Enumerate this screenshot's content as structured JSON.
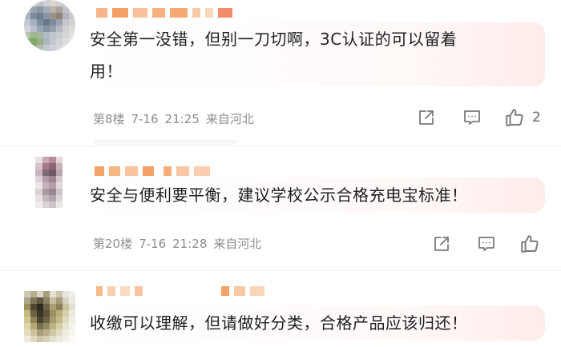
{
  "colors": {
    "text": "#1e1e1e",
    "meta": "#8e8e8e",
    "icon": "#7a7a7a",
    "nickname_mosaic": "#f5a067",
    "bubble_tint": "#fdecea"
  },
  "comments": [
    {
      "text_line1": "安全第一没错，但别一刀切啊，3C认证的可以留着",
      "text_line2": "用！",
      "floor": "第8楼",
      "date": "7-16",
      "time": "21:25",
      "source": "来自河北",
      "like_count": "2",
      "icons": [
        "share-icon",
        "comment-icon",
        "thumbs-up-icon"
      ]
    },
    {
      "text_line1": "安全与便利要平衡，建议学校公示合格充电宝标准！",
      "floor": "第20楼",
      "date": "7-16",
      "time": "21:28",
      "source": "来自河北",
      "icons": [
        "share-icon",
        "comment-icon",
        "thumbs-up-icon"
      ]
    },
    {
      "text_line1": "收缴可以理解，但请做好分类，合格产品应该归还！"
    }
  ]
}
